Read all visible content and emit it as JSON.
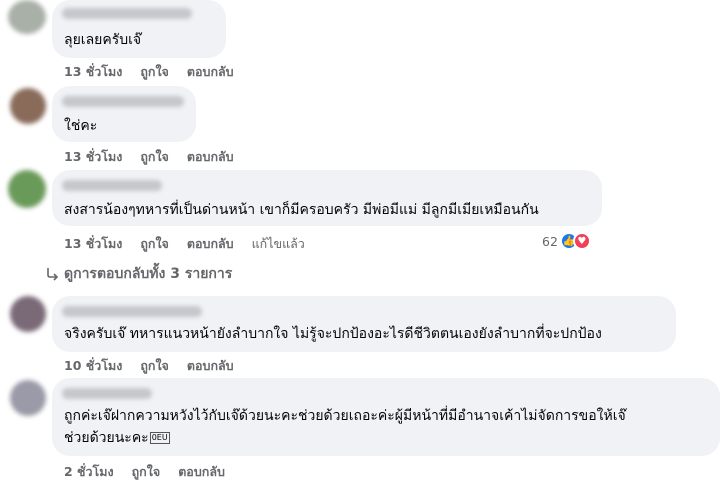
{
  "comments": [
    {
      "text": "ลุยเลยครับเจ๊",
      "time": "13 ชั่วโมง",
      "like": "ถูกใจ",
      "reply": "ตอบกลับ"
    },
    {
      "text": "ใช่คะ",
      "time": "13 ชั่วโมง",
      "like": "ถูกใจ",
      "reply": "ตอบกลับ"
    },
    {
      "text": "สงสารน้องๆทหารที่เป็นด่านหน้า เขาก็มีครอบครัว มีพ่อมีแม่ มีลูกมีเมียเหมือนกัน",
      "time": "13 ชั่วโมง",
      "like": "ถูกใจ",
      "reply": "ตอบกลับ",
      "edited": "แก้ไขแล้ว",
      "reaction_count": "62"
    },
    {
      "text": "จริงครับเจ๊ ทหารแนวหน้ายังลำบากใจ ไม่รู้จะปกป้องอะไรดีชีวิตตนเองยังลำบากที่จะปกป้อง",
      "time": "10 ชั่วโมง",
      "like": "ถูกใจ",
      "reply": "ตอบกลับ"
    },
    {
      "text_line1": "ถูกค่ะเจ๊ฝากความหวังไว้กับเจ๊ด้วยนะคะช่วยด้วยเถอะค่ะผู้มีหน้าที่มีอำนาจเค้าไม่จัดการขอให้เจ๊",
      "text_line2": "ช่วยด้วยนะคะ",
      "emoji_box": "0EU",
      "time": "2 ชั่วโมง",
      "like": "ถูกใจ",
      "reply": "ตอบกลับ"
    }
  ],
  "view_replies": "ดูการตอบกลับทั้ง 3 รายการ",
  "colors": {
    "bubble": "#f0f2f5",
    "meta": "#65676b",
    "like_blue": "#1877f2",
    "love_red": "#f33e58"
  },
  "icons": {
    "like": "thumbs-up-icon",
    "love": "heart-icon",
    "reply_arrow": "reply-arrow-icon"
  }
}
